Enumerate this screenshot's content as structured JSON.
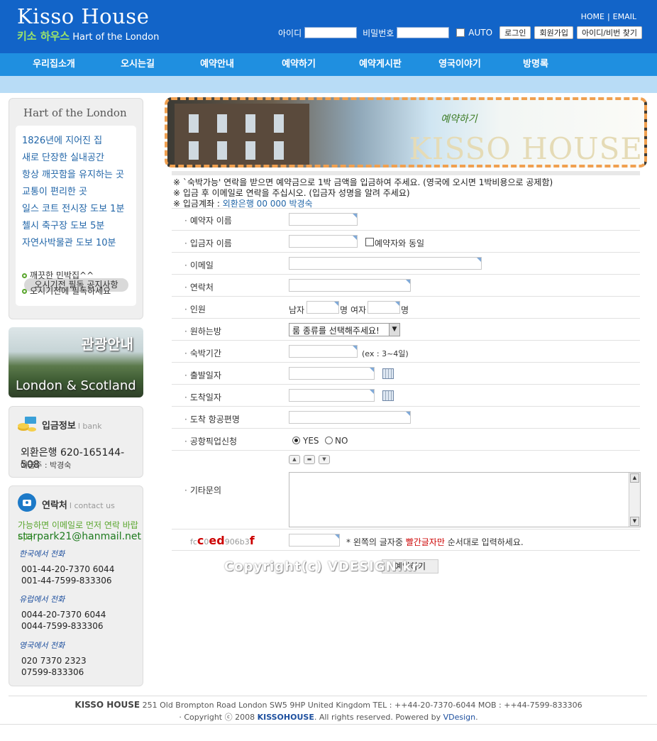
{
  "header": {
    "logo_title": "Kisso House",
    "logo_kr": "키소 하우스",
    "logo_sub": "Hart of the London",
    "links": [
      "HOME",
      "EMAIL"
    ],
    "id_label": "아이디",
    "pw_label": "비밀번호",
    "auto_label": "AUTO",
    "login_btn": "로그인",
    "join_btn": "회원가입",
    "find_btn": "아이디/비번 찾기"
  },
  "nav": [
    "우리집소개",
    "오시는길",
    "예약안내",
    "예약하기",
    "예약게시판",
    "영국이야기",
    "방명록"
  ],
  "sidebar": {
    "box_title": "Hart of the London",
    "features": [
      "1826년에 지어진 집",
      "새로 단장한 실내공간",
      "항상 깨끗함을 유지하는 곳",
      "교통이 편리한 곳",
      "일스 코트 전시장 도보 1분",
      "첼시 축구장 도보 5분",
      "자연사박물관 도보 10분"
    ],
    "notice_title": "오시기전 필독 공지사항",
    "notices": [
      "깨끗한 민박집^^",
      "오시기전에 필독하세요"
    ],
    "tour_title": "관광안내",
    "tour_sub": "London & Scotland",
    "bank_title": "입금정보",
    "bank_en": "l bank",
    "bank_acct": "외환은행 620-165144-508",
    "bank_owner": "예금주 : 박경숙",
    "contact_title": "연락처",
    "contact_en": "l contact us",
    "contact_note": "가능하면 이메일로 먼저 연락 바랍니다",
    "contact_email": "starpark21@hanmail.net",
    "regions": [
      {
        "label": "한국에서 전화",
        "phones": [
          "001-44-20-7370 6044",
          "001-44-7599-833306"
        ]
      },
      {
        "label": "유럽에서 전화",
        "phones": [
          "0044-20-7370 6044",
          "0044-7599-833306"
        ]
      },
      {
        "label": "영국에서 전화",
        "phones": [
          "020 7370 2323",
          "07599-833306"
        ]
      }
    ]
  },
  "banner": {
    "label": "예약하기",
    "brand": "KISSO HOUSE"
  },
  "notices": {
    "line1": "※ `숙박가능' 연락을 받으면 예약금으로 1박 금액을 입금하여 주세요. (영국에 오시면 1박비용으로 공제함)",
    "line2": "※ 입금 후 이메일로 연락을 주십시오. (입금자 성명을 알려 주세요)",
    "line3_prefix": "※ 입금계좌 : ",
    "line3_acct": "외환은행 00 000 박경숙"
  },
  "form": {
    "rows": [
      "예약자 이름",
      "입금자 이름",
      "이메일",
      "연락처",
      "인원",
      "원하는방",
      "숙박기간",
      "출발일자",
      "도착일자",
      "도착 항공편명",
      "공항픽업신청",
      "기타문의"
    ],
    "same_as_booker": "예약자와 동일",
    "male": "남자",
    "female": "여자",
    "unit": "명",
    "room_select": "룸 종류를 선택해주세요!",
    "stay_hint": "(ex : 3~4일)",
    "yes": "YES",
    "no": "NO",
    "captcha_prefix": "fc",
    "captcha_r1": "c",
    "captcha_mid": "0",
    "captcha_r2": "ed",
    "captcha_mid2": "906b3",
    "captcha_r3": "f",
    "captcha_note_a": "* 왼쪽의 글자중 ",
    "captcha_note_red": "빨간글자만",
    "captcha_note_b": " 순서대로 입력하세요.",
    "submit": "예약하기",
    "watermark": "Copyright(c) VDESIGN.kr"
  },
  "footer": {
    "brand": "KISSO HOUSE",
    "address": " 251 Old Brompton Road London SW5 9HP United Kingdom TEL : ++44-20-7370-6044 MOB : ++44-7599-833306",
    "copy_a": "· Copyright ⓒ 2008 ",
    "copy_brand": "KISSOHOUSE",
    "copy_b": ". All rights reserved. Powered by ",
    "copy_vd": "VDesign",
    "copy_end": "."
  },
  "colors": {
    "header": "#1264c8",
    "nav": "#1f8fe0",
    "subnav": "#b8dcf6",
    "accent_green": "#5aa62e"
  }
}
